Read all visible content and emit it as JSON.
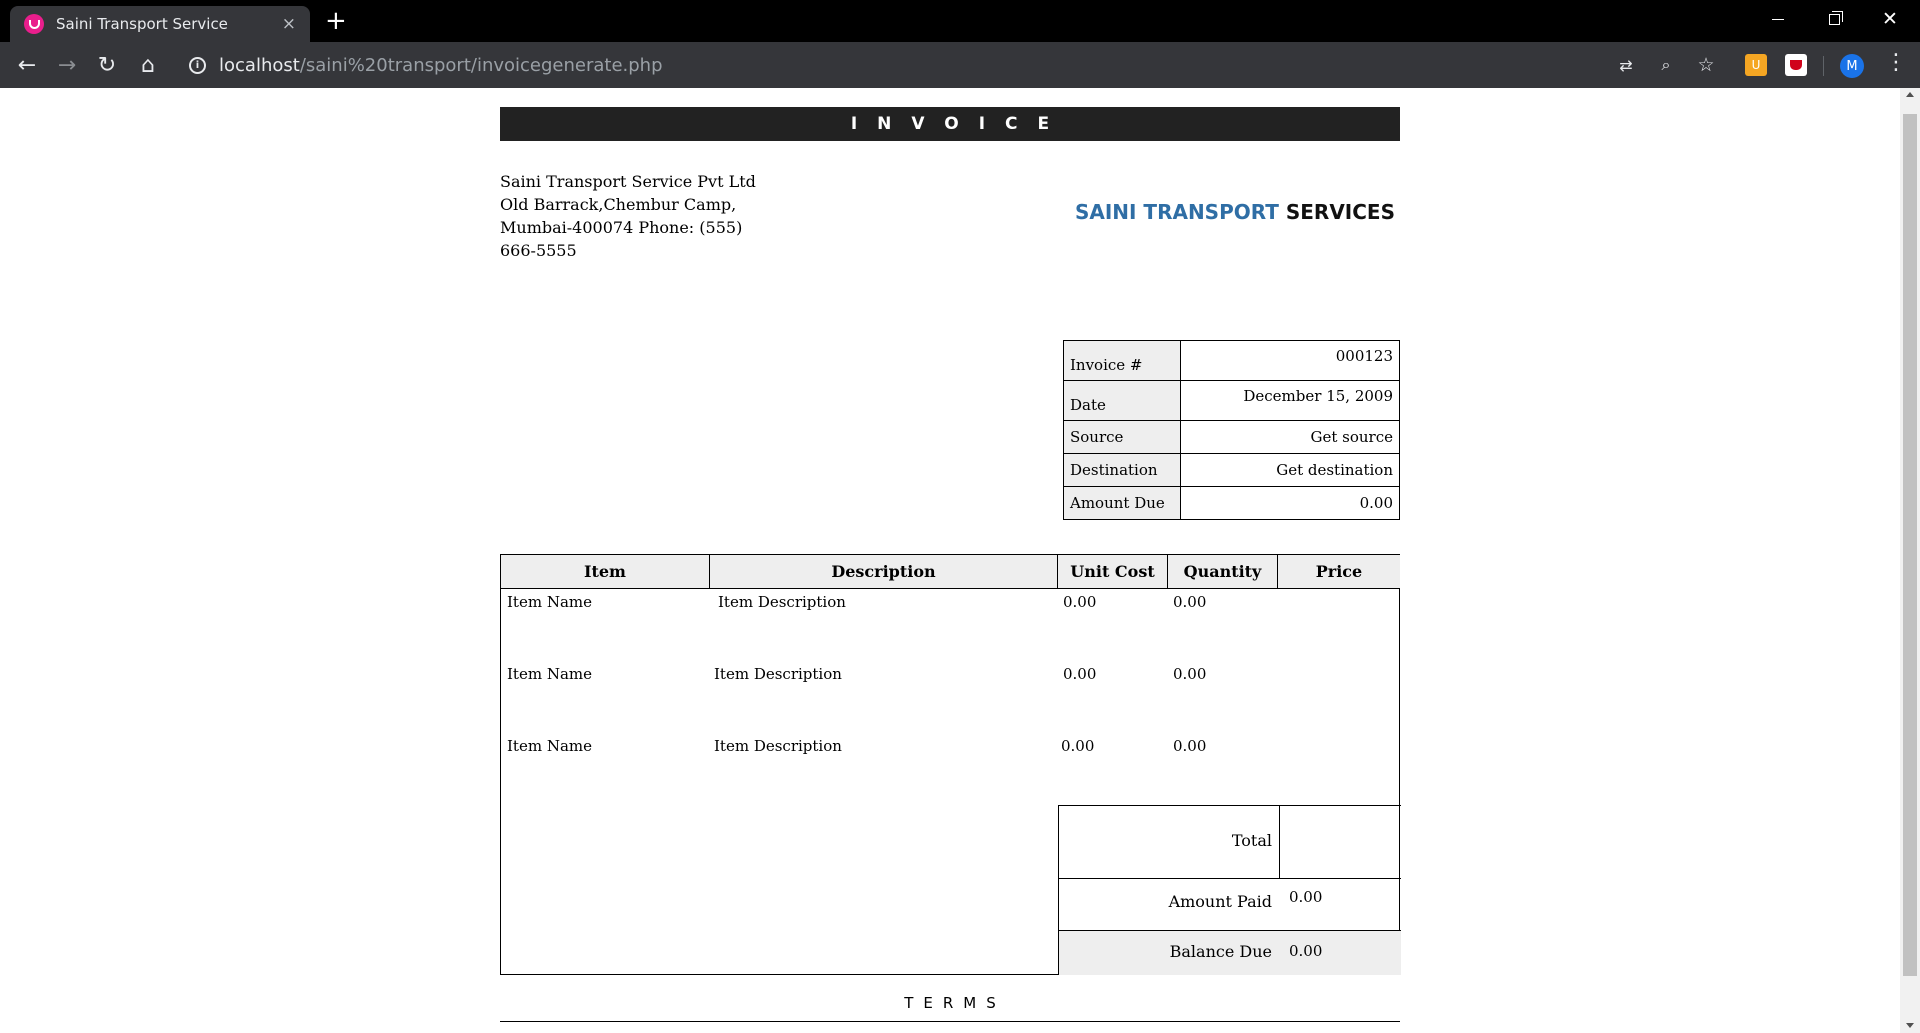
{
  "browser": {
    "tab_title": "Saini Transport Service",
    "tab_close": "×",
    "new_tab": "+",
    "url_host": "localhost",
    "url_path": "/saini%20transport/invoicegenerate.php",
    "avatar_letter": "M"
  },
  "invoice": {
    "header": "INVOICE",
    "address": "Saini Transport Service Pvt Ltd Old Barrack,Chembur Camp, Mumbai-400074 Phone: (555) 666-5555",
    "brand_part1": "SAINI TRANSPORT",
    "brand_part2": "SERVICES",
    "meta": [
      {
        "label": "Invoice #",
        "value": "000123"
      },
      {
        "label": "Date",
        "value": "December 15, 2009"
      },
      {
        "label": "Source",
        "value": "Get source"
      },
      {
        "label": "Destination",
        "value": "Get destination"
      },
      {
        "label": "Amount Due",
        "value": "0.00"
      }
    ],
    "columns": [
      "Item",
      "Description",
      "Unit Cost",
      "Quantity",
      "Price"
    ],
    "rows": [
      {
        "item": "Item Name",
        "description": "Item Description",
        "unit_cost": "0.00",
        "quantity": "0.00"
      },
      {
        "item": "Item Name",
        "description": "Item Description",
        "unit_cost": "0.00",
        "quantity": "0.00"
      },
      {
        "item": "Item Name",
        "description": "Item Description",
        "unit_cost": "0.00",
        "quantity": "0.00"
      }
    ],
    "totals": {
      "total_label": "Total",
      "amount_paid_label": "Amount Paid",
      "amount_paid_value": "0.00",
      "balance_due_label": "Balance Due",
      "balance_due_value": "0.00"
    },
    "terms": "TERMS"
  }
}
